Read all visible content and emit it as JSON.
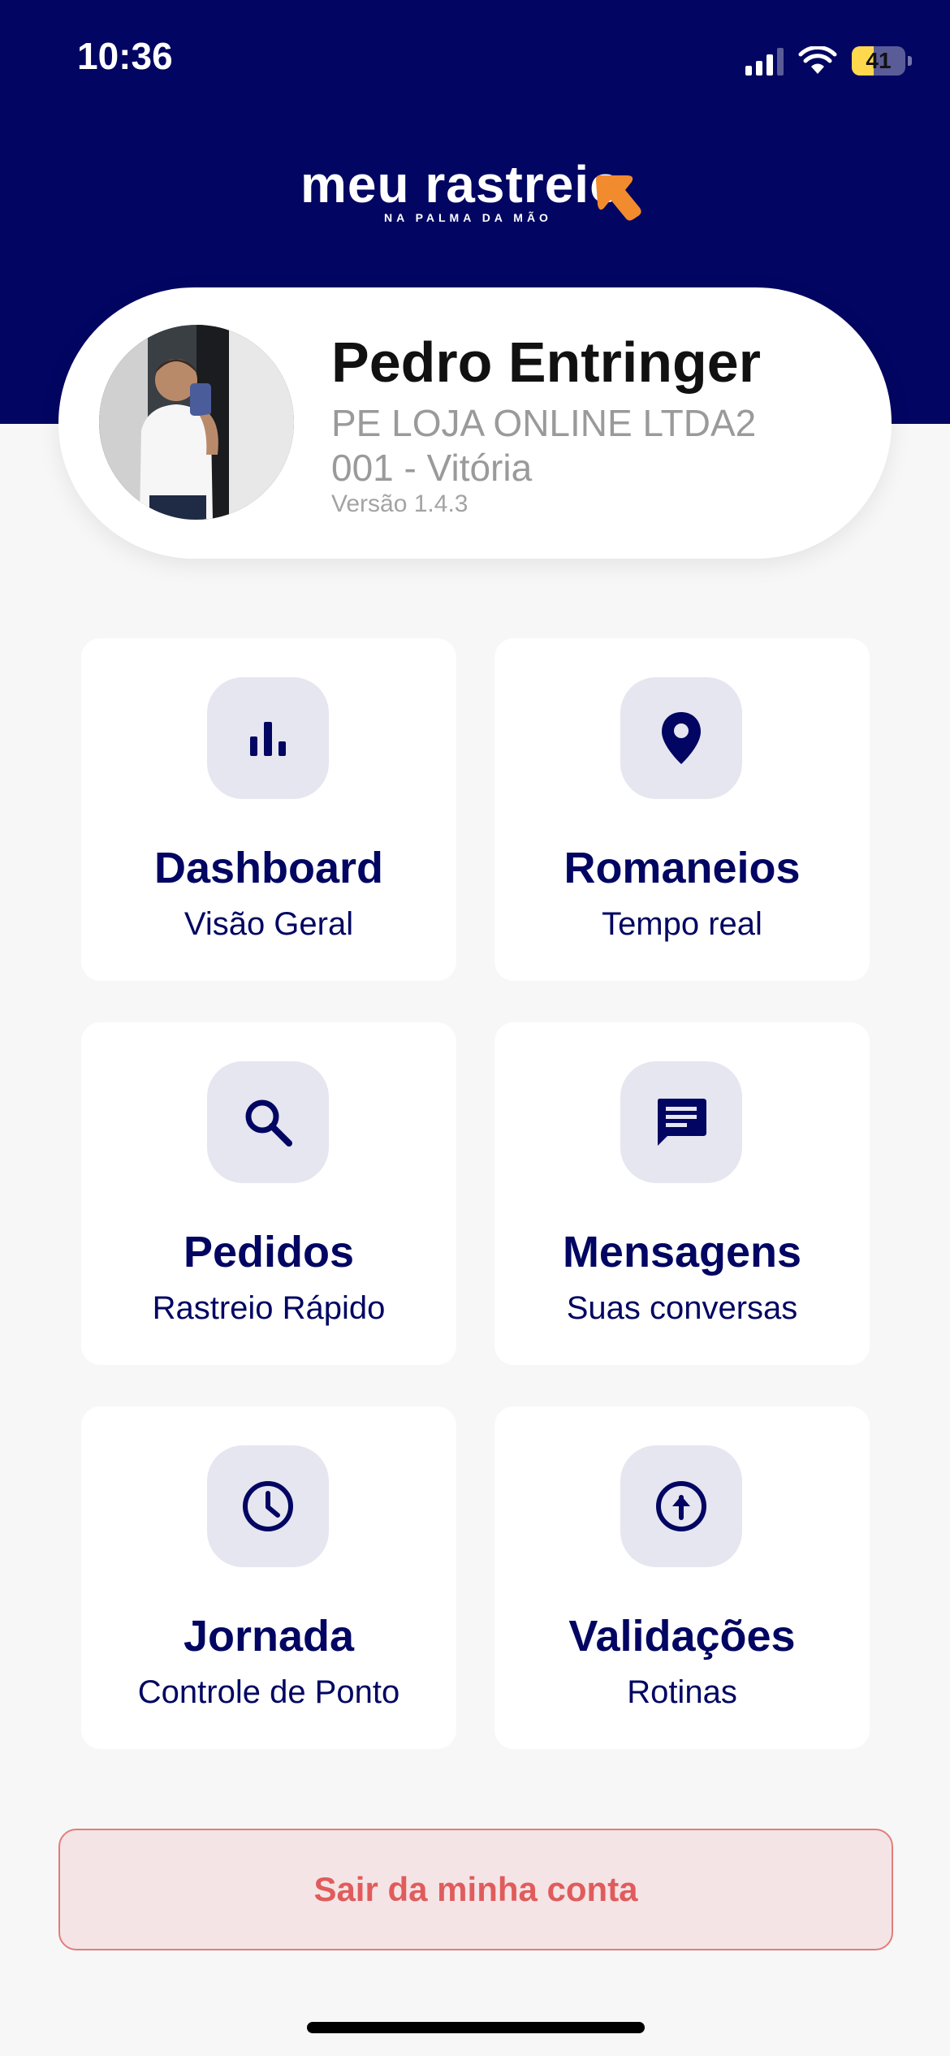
{
  "status_bar": {
    "time": "10:36",
    "battery": "41",
    "battery_level_percent": 41
  },
  "logo": {
    "text": "meu rastreio",
    "subtitle": "NA PALMA DA MÃO"
  },
  "profile": {
    "name": "Pedro Entringer",
    "company": "PE LOJA ONLINE LTDA2",
    "branch": "001 - Vitória",
    "version": "Versão 1.4.3"
  },
  "tiles": [
    {
      "title": "Dashboard",
      "subtitle": "Visão Geral",
      "icon": "bar-chart-icon"
    },
    {
      "title": "Romaneios",
      "subtitle": "Tempo real",
      "icon": "location-pin-icon"
    },
    {
      "title": "Pedidos",
      "subtitle": "Rastreio Rápido",
      "icon": "search-icon"
    },
    {
      "title": "Mensagens",
      "subtitle": "Suas conversas",
      "icon": "message-icon"
    },
    {
      "title": "Jornada",
      "subtitle": "Controle de Ponto",
      "icon": "clock-icon"
    },
    {
      "title": "Validações",
      "subtitle": "Rotinas",
      "icon": "upload-arrow-icon"
    }
  ],
  "logout": {
    "label": "Sair da minha conta"
  },
  "colors": {
    "primary": "#020662",
    "accent": "#f28a2e",
    "danger": "#e05c5c",
    "tile_icon_bg": "#e6e6f0"
  }
}
